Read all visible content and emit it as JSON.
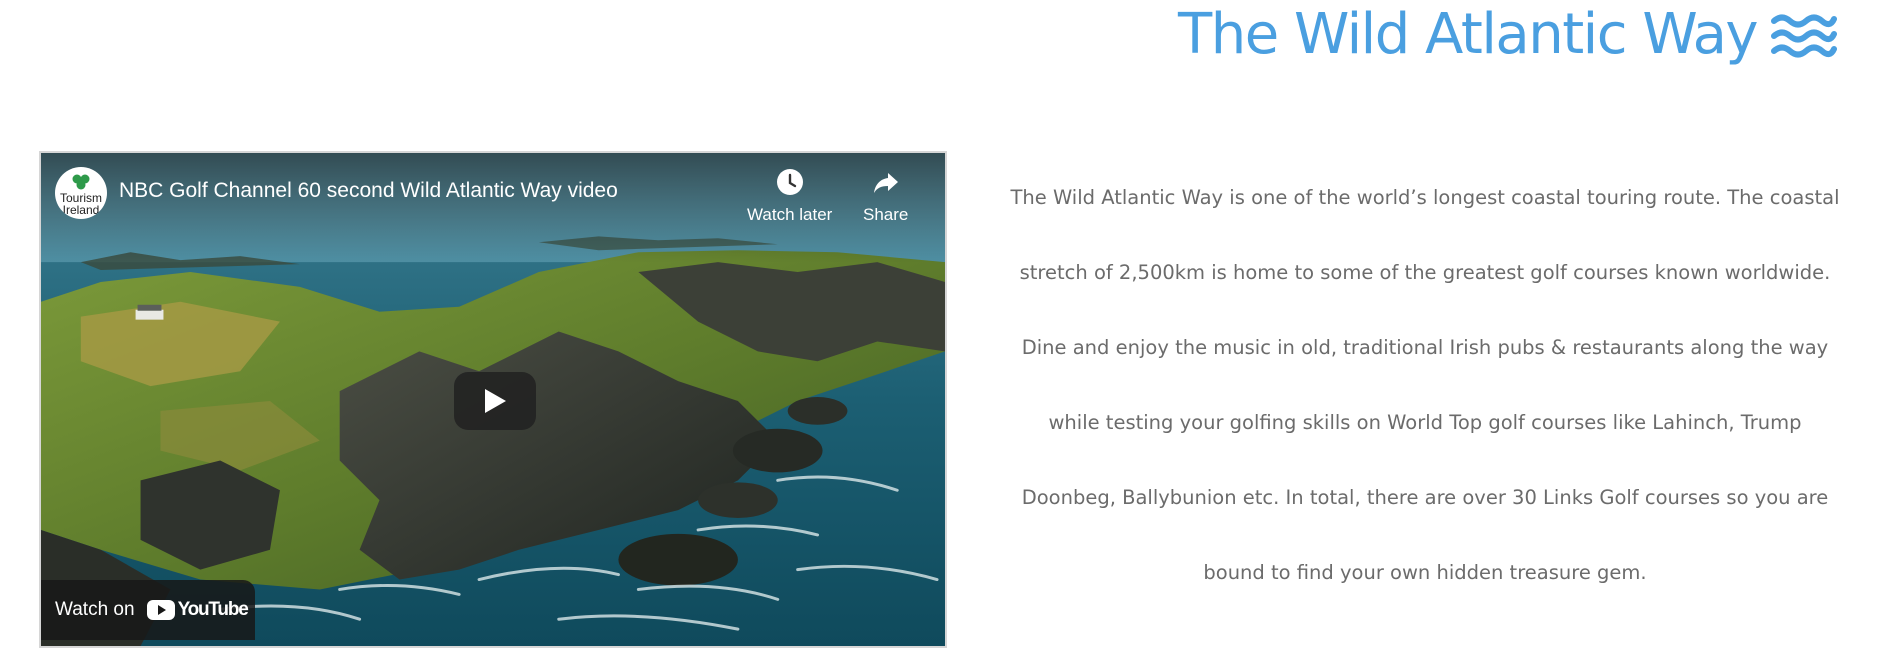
{
  "heading": {
    "title": "The Wild Atlantic Way",
    "icon": "waves-icon",
    "color": "#4a9fe0"
  },
  "video": {
    "title": "NBC Golf Channel 60 second Wild Atlantic Way video",
    "channel_avatar_text": "Tourism Ireland",
    "watch_later_label": "Watch later",
    "share_label": "Share",
    "watch_on_label": "Watch on",
    "youtube_logo_text": "YouTube",
    "play_icon": "play-icon"
  },
  "description": {
    "lines": [
      "The Wild Atlantic Way is one of the world’s longest coastal touring route. The coastal",
      "stretch of 2,500km is home to some of the greatest golf courses known worldwide.",
      "Dine and enjoy the music in old, traditional Irish pubs & restaurants along the way",
      "while testing your golfing skills on World Top golf courses like Lahinch, Trump",
      "Doonbeg, Ballybunion etc. In total, there are over 30 Links Golf courses so you are",
      "bound to find your own hidden treasure gem."
    ],
    "color": "#6b6b6b"
  }
}
